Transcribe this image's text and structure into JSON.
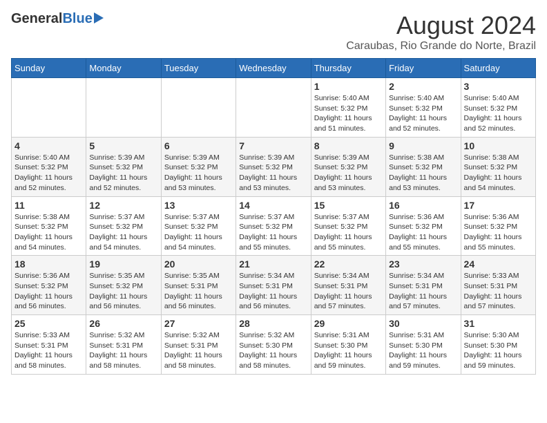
{
  "logo": {
    "general": "General",
    "blue": "Blue"
  },
  "title": "August 2024",
  "subtitle": "Caraubas, Rio Grande do Norte, Brazil",
  "days_header": [
    "Sunday",
    "Monday",
    "Tuesday",
    "Wednesday",
    "Thursday",
    "Friday",
    "Saturday"
  ],
  "weeks": [
    [
      {
        "day": "",
        "info": ""
      },
      {
        "day": "",
        "info": ""
      },
      {
        "day": "",
        "info": ""
      },
      {
        "day": "",
        "info": ""
      },
      {
        "day": "1",
        "info": "Sunrise: 5:40 AM\nSunset: 5:32 PM\nDaylight: 11 hours and 51 minutes."
      },
      {
        "day": "2",
        "info": "Sunrise: 5:40 AM\nSunset: 5:32 PM\nDaylight: 11 hours and 52 minutes."
      },
      {
        "day": "3",
        "info": "Sunrise: 5:40 AM\nSunset: 5:32 PM\nDaylight: 11 hours and 52 minutes."
      }
    ],
    [
      {
        "day": "4",
        "info": "Sunrise: 5:40 AM\nSunset: 5:32 PM\nDaylight: 11 hours and 52 minutes."
      },
      {
        "day": "5",
        "info": "Sunrise: 5:39 AM\nSunset: 5:32 PM\nDaylight: 11 hours and 52 minutes."
      },
      {
        "day": "6",
        "info": "Sunrise: 5:39 AM\nSunset: 5:32 PM\nDaylight: 11 hours and 53 minutes."
      },
      {
        "day": "7",
        "info": "Sunrise: 5:39 AM\nSunset: 5:32 PM\nDaylight: 11 hours and 53 minutes."
      },
      {
        "day": "8",
        "info": "Sunrise: 5:39 AM\nSunset: 5:32 PM\nDaylight: 11 hours and 53 minutes."
      },
      {
        "day": "9",
        "info": "Sunrise: 5:38 AM\nSunset: 5:32 PM\nDaylight: 11 hours and 53 minutes."
      },
      {
        "day": "10",
        "info": "Sunrise: 5:38 AM\nSunset: 5:32 PM\nDaylight: 11 hours and 54 minutes."
      }
    ],
    [
      {
        "day": "11",
        "info": "Sunrise: 5:38 AM\nSunset: 5:32 PM\nDaylight: 11 hours and 54 minutes."
      },
      {
        "day": "12",
        "info": "Sunrise: 5:37 AM\nSunset: 5:32 PM\nDaylight: 11 hours and 54 minutes."
      },
      {
        "day": "13",
        "info": "Sunrise: 5:37 AM\nSunset: 5:32 PM\nDaylight: 11 hours and 54 minutes."
      },
      {
        "day": "14",
        "info": "Sunrise: 5:37 AM\nSunset: 5:32 PM\nDaylight: 11 hours and 55 minutes."
      },
      {
        "day": "15",
        "info": "Sunrise: 5:37 AM\nSunset: 5:32 PM\nDaylight: 11 hours and 55 minutes."
      },
      {
        "day": "16",
        "info": "Sunrise: 5:36 AM\nSunset: 5:32 PM\nDaylight: 11 hours and 55 minutes."
      },
      {
        "day": "17",
        "info": "Sunrise: 5:36 AM\nSunset: 5:32 PM\nDaylight: 11 hours and 55 minutes."
      }
    ],
    [
      {
        "day": "18",
        "info": "Sunrise: 5:36 AM\nSunset: 5:32 PM\nDaylight: 11 hours and 56 minutes."
      },
      {
        "day": "19",
        "info": "Sunrise: 5:35 AM\nSunset: 5:32 PM\nDaylight: 11 hours and 56 minutes."
      },
      {
        "day": "20",
        "info": "Sunrise: 5:35 AM\nSunset: 5:31 PM\nDaylight: 11 hours and 56 minutes."
      },
      {
        "day": "21",
        "info": "Sunrise: 5:34 AM\nSunset: 5:31 PM\nDaylight: 11 hours and 56 minutes."
      },
      {
        "day": "22",
        "info": "Sunrise: 5:34 AM\nSunset: 5:31 PM\nDaylight: 11 hours and 57 minutes."
      },
      {
        "day": "23",
        "info": "Sunrise: 5:34 AM\nSunset: 5:31 PM\nDaylight: 11 hours and 57 minutes."
      },
      {
        "day": "24",
        "info": "Sunrise: 5:33 AM\nSunset: 5:31 PM\nDaylight: 11 hours and 57 minutes."
      }
    ],
    [
      {
        "day": "25",
        "info": "Sunrise: 5:33 AM\nSunset: 5:31 PM\nDaylight: 11 hours and 58 minutes."
      },
      {
        "day": "26",
        "info": "Sunrise: 5:32 AM\nSunset: 5:31 PM\nDaylight: 11 hours and 58 minutes."
      },
      {
        "day": "27",
        "info": "Sunrise: 5:32 AM\nSunset: 5:31 PM\nDaylight: 11 hours and 58 minutes."
      },
      {
        "day": "28",
        "info": "Sunrise: 5:32 AM\nSunset: 5:30 PM\nDaylight: 11 hours and 58 minutes."
      },
      {
        "day": "29",
        "info": "Sunrise: 5:31 AM\nSunset: 5:30 PM\nDaylight: 11 hours and 59 minutes."
      },
      {
        "day": "30",
        "info": "Sunrise: 5:31 AM\nSunset: 5:30 PM\nDaylight: 11 hours and 59 minutes."
      },
      {
        "day": "31",
        "info": "Sunrise: 5:30 AM\nSunset: 5:30 PM\nDaylight: 11 hours and 59 minutes."
      }
    ]
  ]
}
